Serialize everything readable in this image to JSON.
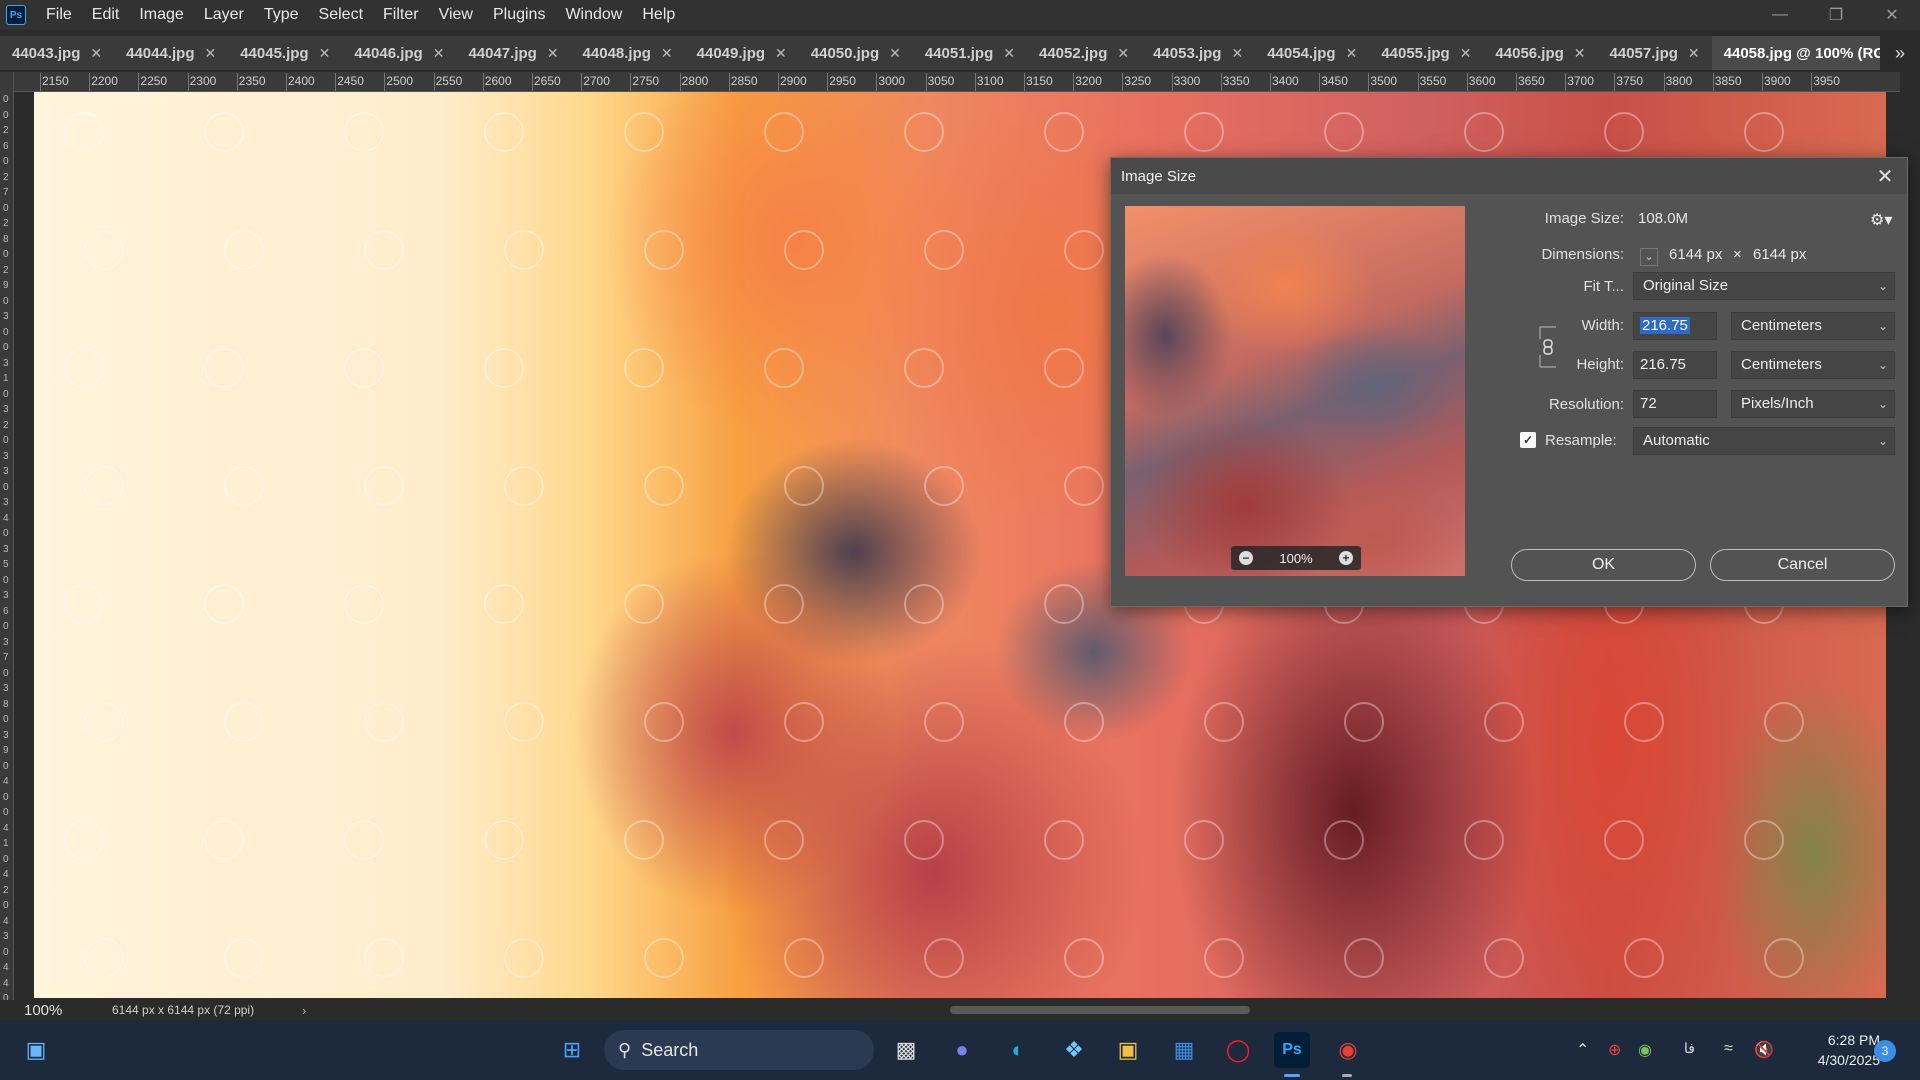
{
  "app": {
    "logo": "Ps",
    "accent": "#31a8ff"
  },
  "menu": [
    "File",
    "Edit",
    "Image",
    "Layer",
    "Type",
    "Select",
    "Filter",
    "View",
    "Plugins",
    "Window",
    "Help"
  ],
  "window_controls": [
    "minimize-icon",
    "restore-icon",
    "close-icon"
  ],
  "tabs": [
    "44043.jpg",
    "44044.jpg",
    "44045.jpg",
    "44046.jpg",
    "44047.jpg",
    "44048.jpg",
    "44049.jpg",
    "44050.jpg",
    "44051.jpg",
    "44052.jpg",
    "44053.jpg",
    "44054.jpg",
    "44055.jpg",
    "44056.jpg",
    "44057.jpg",
    "44058.jpg @ 100% (RGB/8#)"
  ],
  "tab_overflow": "»",
  "ruler_top": [
    "2150",
    "2200",
    "2250",
    "2300",
    "2350",
    "2400",
    "2450",
    "2500",
    "2550",
    "2600",
    "2650",
    "2700",
    "2750",
    "2800",
    "2850",
    "2900",
    "2950",
    "3000",
    "3050",
    "3100",
    "3150",
    "3200",
    "3250",
    "3300",
    "3350",
    "3400",
    "3450",
    "3500",
    "3550",
    "3600",
    "3650",
    "3700",
    "3750",
    "3800",
    "3850",
    "3900",
    "3950"
  ],
  "ruler_left": [
    "0",
    "0",
    "2",
    "6",
    "0",
    "2",
    "7",
    "0",
    "2",
    "8",
    "0",
    "2",
    "9",
    "0",
    "3",
    "0",
    "0",
    "3",
    "1",
    "0",
    "3",
    "2",
    "0",
    "3",
    "3",
    "0",
    "3",
    "4",
    "0",
    "3",
    "5",
    "0",
    "3",
    "6",
    "0",
    "3",
    "7",
    "0",
    "3",
    "8",
    "0",
    "3",
    "9",
    "0",
    "4",
    "0",
    "0",
    "4",
    "1",
    "0",
    "4",
    "2",
    "0",
    "4",
    "3",
    "0",
    "4",
    "4",
    "0"
  ],
  "dialog": {
    "title": "Image Size",
    "image_size_label": "Image Size:",
    "image_size_value": "108.0M",
    "dimensions_label": "Dimensions:",
    "dim_width": "6144 px",
    "dim_sep": "×",
    "dim_height": "6144 px",
    "fit_label": "Fit T...",
    "fit_value": "Original Size",
    "width_label": "Width:",
    "width_value": "216.75",
    "width_unit": "Centimeters",
    "height_label": "Height:",
    "height_value": "216.75",
    "height_unit": "Centimeters",
    "resolution_label": "Resolution:",
    "resolution_value": "72",
    "resolution_unit": "Pixels/Inch",
    "resample_label": "Resample:",
    "resample_checked": true,
    "resample_value": "Automatic",
    "preview_zoom": "100%",
    "ok_label": "OK",
    "cancel_label": "Cancel"
  },
  "status": {
    "zoom": "100%",
    "info": "6144 px x 6144 px (72 ppi)",
    "arrow": "›"
  },
  "taskbar": {
    "search_label": "Search",
    "time": "6:28 PM",
    "date": "4/30/2025",
    "notification_count": "3",
    "lang": "فا",
    "apps": [
      "widgets-icon",
      "start-icon",
      "search-icon",
      "task-view-icon",
      "meet-icon",
      "edge-icon",
      "copilot-icon",
      "file-explorer-icon",
      "store-icon",
      "opera-icon",
      "photoshop-icon",
      "chrome-icon"
    ]
  }
}
